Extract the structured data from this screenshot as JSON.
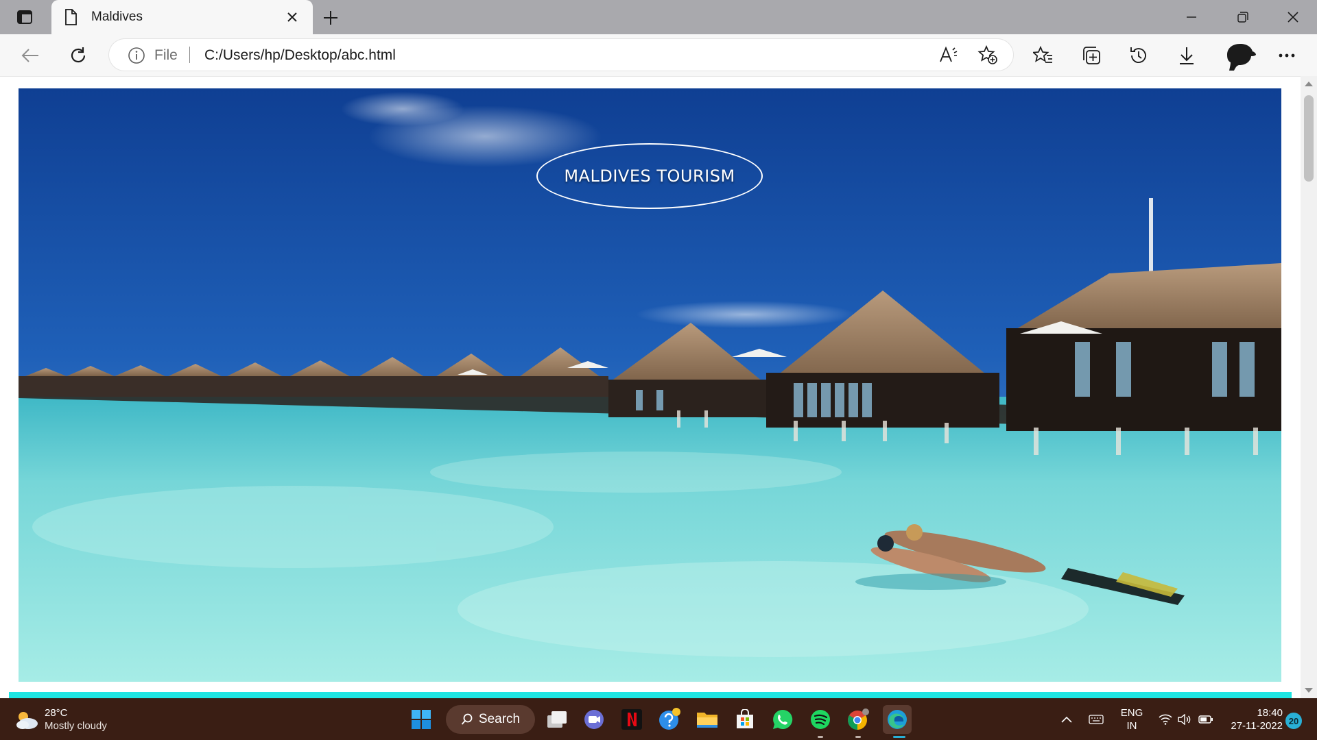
{
  "browser": {
    "tab": {
      "title": "Maldives"
    },
    "address": {
      "scheme": "File",
      "url": "C:/Users/hp/Desktop/abc.html"
    }
  },
  "page": {
    "hero_title": "MALDIVES TOURISM",
    "colors": {
      "band": "#1ee5e2",
      "sky_top": "#1e4fa0",
      "water": "#7fd9d8"
    }
  },
  "taskbar": {
    "weather": {
      "temp": "28°C",
      "desc": "Mostly cloudy"
    },
    "search_label": "Search",
    "language": {
      "line1": "ENG",
      "line2": "IN"
    },
    "clock": {
      "time": "18:40",
      "date": "27-11-2022"
    },
    "notifications": "20"
  },
  "icons": [
    "tab-actions-icon",
    "document-icon",
    "close-icon",
    "plus-icon",
    "minimize-icon",
    "restore-icon",
    "window-close-icon",
    "back-arrow-icon",
    "refresh-icon",
    "info-icon",
    "read-aloud-icon",
    "add-favorite-icon",
    "favorites-icon",
    "collections-icon",
    "history-icon",
    "download-icon",
    "more-icon",
    "windows-start-icon",
    "task-view-icon",
    "teams-icon",
    "netflix-icon",
    "help-icon",
    "file-explorer-icon",
    "store-icon",
    "whatsapp-icon",
    "spotify-icon",
    "chrome-icon",
    "edge-icon",
    "chevron-up-icon",
    "keyboard-icon",
    "wifi-icon",
    "volume-icon",
    "battery-icon"
  ]
}
